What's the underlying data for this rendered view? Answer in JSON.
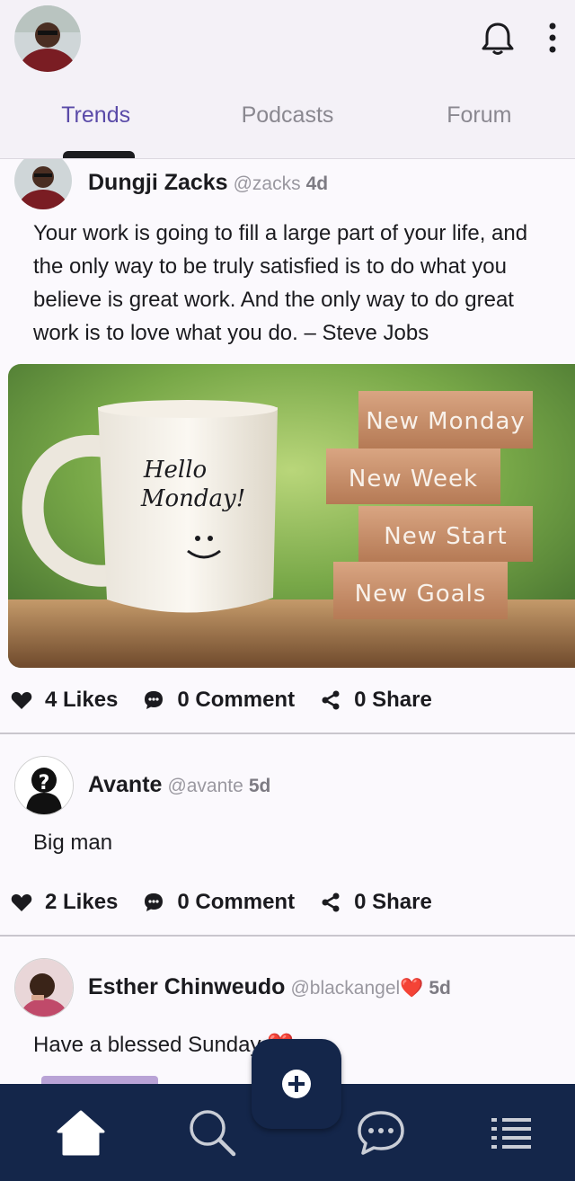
{
  "tabs": [
    {
      "label": "Trends",
      "active": true
    },
    {
      "label": "Podcasts",
      "active": false
    },
    {
      "label": "Forum",
      "active": false
    }
  ],
  "posts": [
    {
      "author": "Dungji Zacks",
      "handle": "@zacks",
      "time": "4d",
      "text": "Your work is going to fill a large part of your life, and the only way to be truly satisfied is to do what you believe is great work. And the only way to do great work is to love what you do. – Steve Jobs",
      "image": {
        "mug_text_line1": "Hello",
        "mug_text_line2": "Monday!",
        "blocks": [
          "New Monday",
          "New Week",
          "New Start",
          "New Goals"
        ]
      },
      "likes": "4 Likes",
      "comments": "0 Comment",
      "shares": "0 Share"
    },
    {
      "author": "Avante",
      "handle": "@avante",
      "time": "5d",
      "text": "Big man",
      "likes": "2 Likes",
      "comments": "0 Comment",
      "shares": "0 Share"
    },
    {
      "author": "Esther Chinweudo",
      "handle": "@blackangel❤️",
      "time": "5d",
      "text": "Have a blessed Sunday ❤️"
    }
  ],
  "icons": {
    "top": [
      "avatar",
      "bell-icon",
      "more-vertical-icon"
    ],
    "bottom_nav": [
      "home-icon",
      "search-icon",
      "chat-icon",
      "list-icon"
    ],
    "fab": "plus-icon"
  },
  "colors": {
    "accent": "#5a4aa8",
    "nav_bg": "#14264a",
    "heart": "#e0202a"
  }
}
